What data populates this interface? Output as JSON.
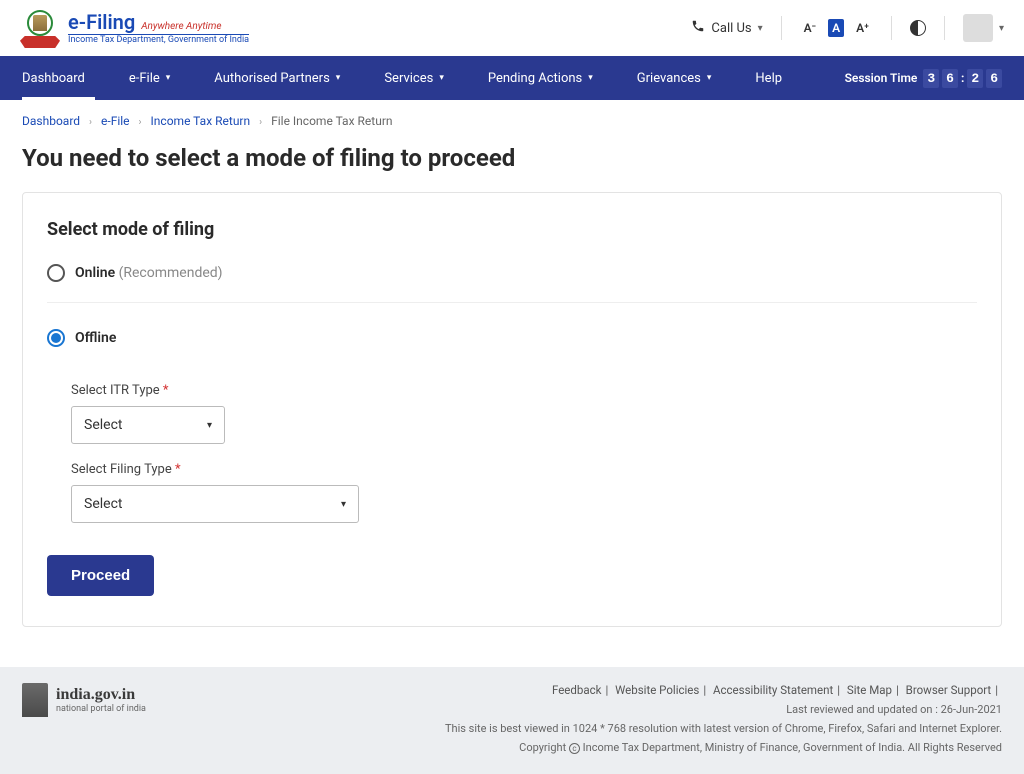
{
  "header": {
    "logo_main": "e-Filing",
    "logo_tag": "Anywhere Anytime",
    "logo_sub": "Income Tax Department, Government of India",
    "call_us": "Call Us",
    "font_small": "A⁻",
    "font_mid": "A",
    "font_large": "A⁺"
  },
  "nav": {
    "items": [
      "Dashboard",
      "e-File",
      "Authorised Partners",
      "Services",
      "Pending Actions",
      "Grievances",
      "Help"
    ],
    "session_label": "Session Time",
    "session_m1": "3",
    "session_m2": "6",
    "session_s1": "2",
    "session_s2": "6"
  },
  "breadcrumb": {
    "items": [
      "Dashboard",
      "e-File",
      "Income Tax Return",
      "File Income Tax Return"
    ]
  },
  "page": {
    "title": "You need to select a mode of filing to proceed"
  },
  "card": {
    "title": "Select mode of filing",
    "option_online": "Online",
    "option_online_hint": "(Recommended)",
    "option_offline": "Offline",
    "itr_type_label": "Select ITR Type",
    "itr_type_value": "Select",
    "filing_type_label": "Select Filing Type",
    "filing_type_value": "Select",
    "proceed": "Proceed"
  },
  "footer": {
    "portal_name": "india.gov.in",
    "portal_sub": "national portal of india",
    "links": [
      "Feedback",
      "Website Policies",
      "Accessibility Statement",
      "Site Map",
      "Browser Support"
    ],
    "updated": "Last reviewed and updated on : 26-Jun-2021",
    "viewed": "This site is best viewed in 1024 * 768 resolution with latest version of Chrome, Firefox, Safari and Internet Explorer.",
    "copyright": "Income Tax Department, Ministry of Finance, Government of India. All Rights Reserved",
    "copyright_prefix": "Copyright"
  }
}
